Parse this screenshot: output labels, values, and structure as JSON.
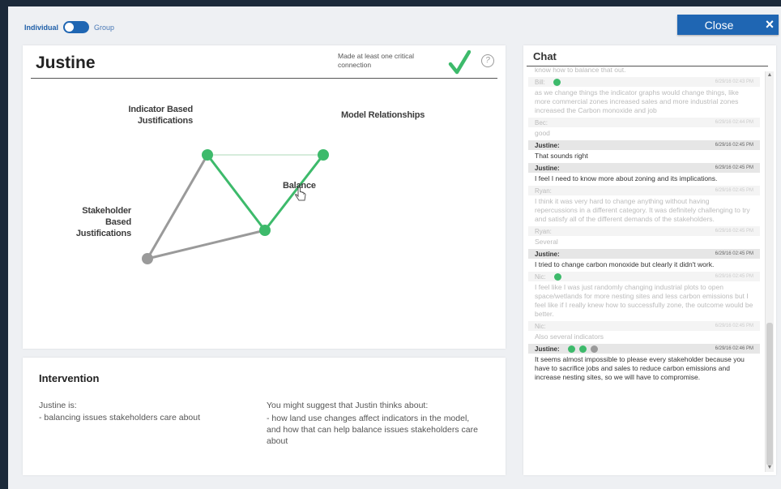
{
  "toggle": {
    "individual": "Individual",
    "group": "Group"
  },
  "close_button": {
    "label": "Close",
    "icon": "×"
  },
  "main": {
    "title": "Justine",
    "critical_text": "Made at least one critical connection",
    "check_icon": "checkmark",
    "help_icon": "?",
    "nodes": {
      "indicator": [
        "Indicator Based",
        "Justifications"
      ],
      "model": "Model Relationships",
      "balance": "Balance",
      "stakeholder": [
        "Stakeholder Based",
        "Justifications"
      ]
    },
    "colors": {
      "green": "#3dba6b",
      "gray": "#9a9a9a",
      "faint": "#c8e6d0"
    }
  },
  "intervention": {
    "title": "Intervention",
    "left_intro": "Justine is:",
    "left_item": "- balancing issues stakeholders care about",
    "right_intro": "You might suggest that Justin thinks about:",
    "right_item": "- how land use changes affect indicators in the model, and how that can help balance issues stakeholders care about"
  },
  "chat": {
    "title": "Chat",
    "messages": [
      {
        "style": "faded-top",
        "text": "know how to balance that out."
      },
      {
        "style": "faded",
        "name": "Bill:",
        "time": "6/29/16 02:43 PM",
        "dots": [
          "#3dba6b"
        ],
        "text": "as we change things the indicator graphs would change things, like more commercial zones increased sales and more industrial zones increased the Carbon monoxide and job"
      },
      {
        "style": "faded",
        "name": "Bec:",
        "time": "6/29/16 02:44 PM",
        "text": "good"
      },
      {
        "style": "strong",
        "name": "Justine:",
        "time": "6/29/16 02:45 PM",
        "text": "That sounds right"
      },
      {
        "style": "strong",
        "name": "Justine:",
        "time": "6/29/16 02:45 PM",
        "text": "I feel I need to know more about zoning and its implications."
      },
      {
        "style": "faded",
        "name": "Ryan:",
        "time": "6/29/16 02:45 PM",
        "text": "I think it was very hard to change anything without having repercussions in a different category. It was definitely challenging to try and satisfy all of the different demands of the stakeholders."
      },
      {
        "style": "faded",
        "name": "Ryan:",
        "time": "6/29/16 02:45 PM",
        "text": "Several"
      },
      {
        "style": "strong",
        "name": "Justine:",
        "time": "6/29/16 02:45 PM",
        "text": "I tried to change carbon monoxide but clearly it didn't work."
      },
      {
        "style": "faded",
        "name": "Nic:",
        "time": "6/29/16 02:45 PM",
        "dots": [
          "#3dba6b"
        ],
        "text": "I feel like I was just randomly changing industrial plots to open space/wetlands for more nesting sites and less carbon emissions but I feel like if I really knew how to successfully zone, the outcome would be better."
      },
      {
        "style": "faded",
        "name": "Nic:",
        "time": "6/29/16 02:45 PM",
        "text": "Also several indicators"
      },
      {
        "style": "strong",
        "name": "Justine:",
        "time": "6/29/16 02:46 PM",
        "dots": [
          "#3dba6b",
          "#3dba6b",
          "#9a9a9a"
        ],
        "text": "It seems almost impossible to please every stakeholder because you have to sacrifice jobs and sales to reduce carbon emissions and increase nesting sites, so we will have to compromise."
      }
    ]
  }
}
